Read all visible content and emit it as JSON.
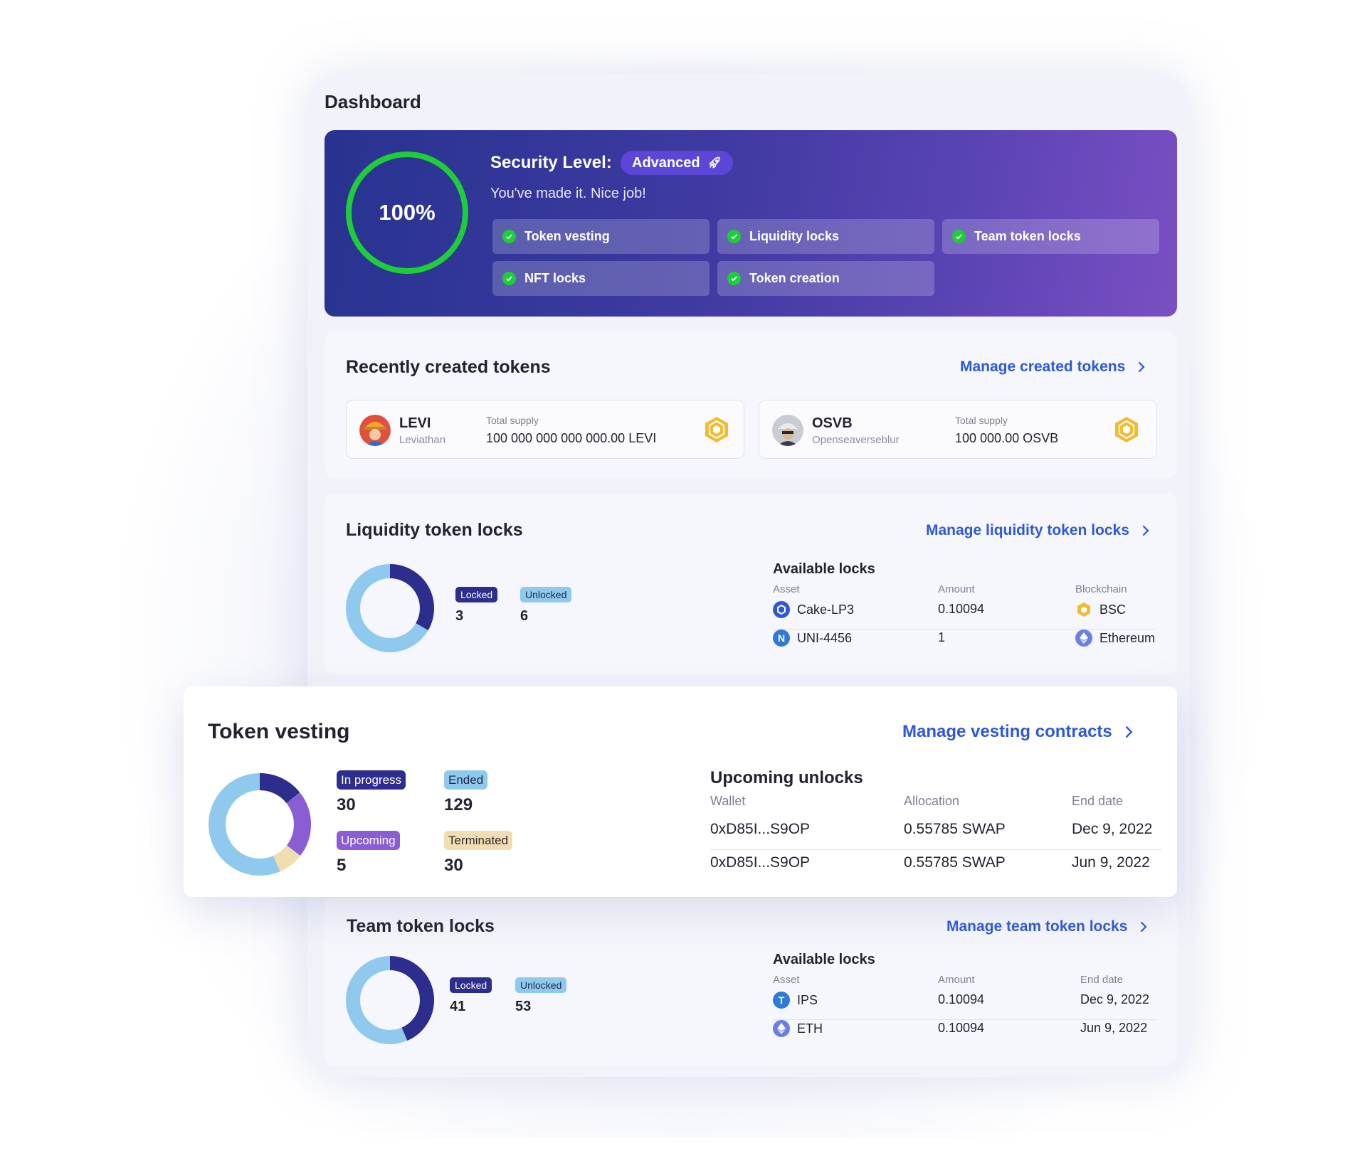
{
  "page": {
    "title": "Dashboard"
  },
  "security": {
    "percent": "100%",
    "title": "Security Level:",
    "level": "Advanced",
    "subtitle": "You've made it. Nice job!",
    "features": [
      "Token vesting",
      "Liquidity locks",
      "Team token locks",
      "NFT locks",
      "Token creation"
    ]
  },
  "recent_tokens": {
    "title": "Recently created tokens",
    "manage_label": "Manage created tokens",
    "items": [
      {
        "symbol": "LEVI",
        "name": "Leviathan",
        "supply_label": "Total supply",
        "supply": "100 000 000 000 000.00 LEVI"
      },
      {
        "symbol": "OSVB",
        "name": "Openseaverseblur",
        "supply_label": "Total supply",
        "supply": "100 000.00 OSVB"
      }
    ]
  },
  "liquidity": {
    "title": "Liquidity token locks",
    "manage_label": "Manage liquidity token locks",
    "locked_label": "Locked",
    "locked": "3",
    "unlocked_label": "Unlocked",
    "unlocked": "6",
    "available_title": "Available locks",
    "headers": [
      "Asset",
      "Amount",
      "Blockchain"
    ],
    "rows": [
      {
        "asset": "Cake-LP3",
        "amount": "0.10094",
        "chain": "BSC"
      },
      {
        "asset": "UNI-4456",
        "amount": "1",
        "chain": "Ethereum"
      }
    ]
  },
  "vesting": {
    "title": "Token vesting",
    "manage_label": "Manage vesting contracts",
    "in_progress_label": "In progress",
    "in_progress": "30",
    "ended_label": "Ended",
    "ended": "129",
    "upcoming_label": "Upcoming",
    "upcoming": "5",
    "terminated_label": "Terminated",
    "terminated": "30",
    "unlocks_title": "Upcoming unlocks",
    "headers": [
      "Wallet",
      "Allocation",
      "End date"
    ],
    "rows": [
      {
        "wallet": "0xD85I...S9OP",
        "allocation": "0.55785 SWAP",
        "end": "Dec 9, 2022"
      },
      {
        "wallet": "0xD85I...S9OP",
        "allocation": "0.55785 SWAP",
        "end": "Jun 9, 2022"
      }
    ]
  },
  "team": {
    "title": "Team token locks",
    "manage_label": "Manage team token locks",
    "locked_label": "Locked",
    "locked": "41",
    "unlocked_label": "Unlocked",
    "unlocked": "53",
    "available_title": "Available locks",
    "headers": [
      "Asset",
      "Amount",
      "End date"
    ],
    "rows": [
      {
        "asset": "IPS",
        "amount": "0.10094",
        "end": "Dec 9, 2022"
      },
      {
        "asset": "ETH",
        "amount": "0.10094",
        "end": "Jun 9, 2022"
      }
    ]
  },
  "colors": {
    "accent": "#2f58d6",
    "success": "#1fcc3a",
    "locked": "#2c2d8c",
    "unlocked": "#8fc9ee",
    "upcoming": "#8b5dd4",
    "terminated": "#f2ddb0"
  }
}
